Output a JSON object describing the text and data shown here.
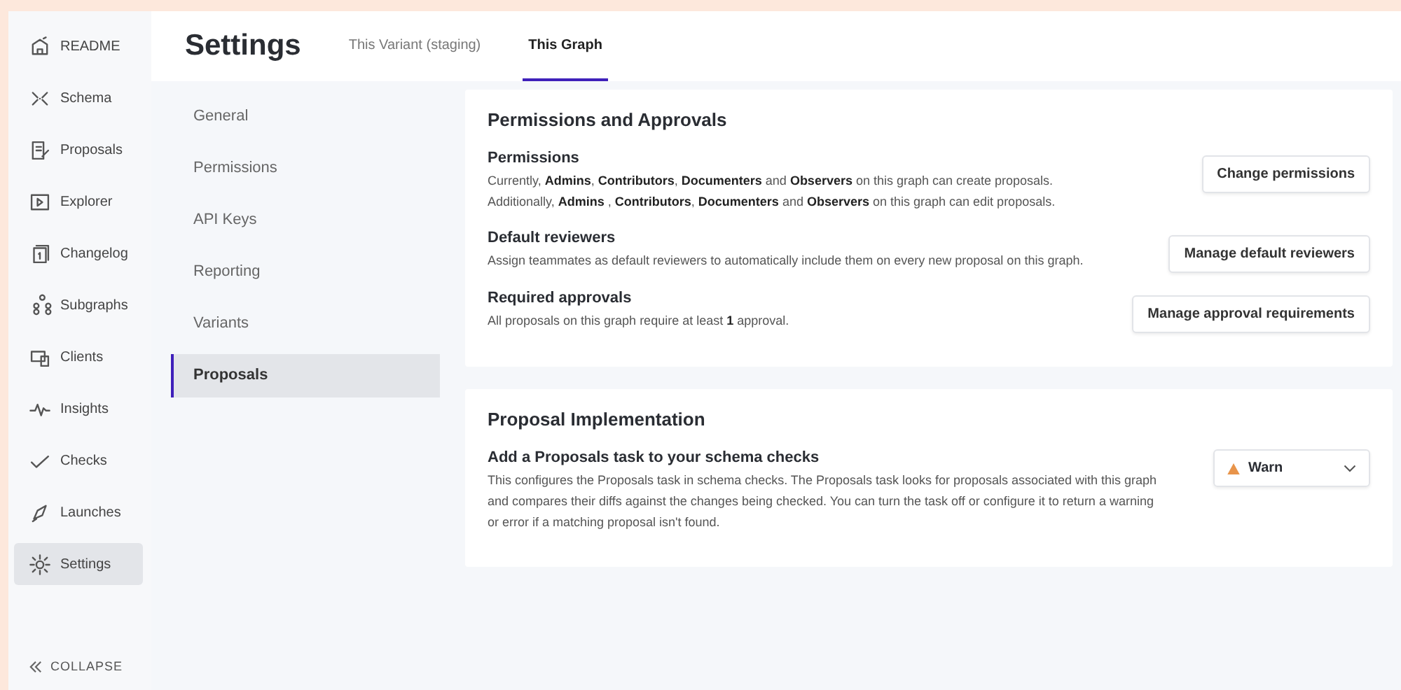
{
  "nav": {
    "items": [
      {
        "label": "README",
        "selected": false
      },
      {
        "label": "Schema",
        "selected": false
      },
      {
        "label": "Proposals",
        "selected": false
      },
      {
        "label": "Explorer",
        "selected": false
      },
      {
        "label": "Changelog",
        "selected": false
      },
      {
        "label": "Subgraphs",
        "selected": false
      },
      {
        "label": "Clients",
        "selected": false
      },
      {
        "label": "Insights",
        "selected": false
      },
      {
        "label": "Checks",
        "selected": false
      },
      {
        "label": "Launches",
        "selected": false
      },
      {
        "label": "Settings",
        "selected": true
      }
    ],
    "collapse": "COLLAPSE"
  },
  "header": {
    "title": "Settings",
    "tabs": [
      {
        "label": "This Variant (staging)",
        "selected": false
      },
      {
        "label": "This Graph",
        "selected": true
      }
    ]
  },
  "subnav": [
    {
      "label": "General",
      "selected": false
    },
    {
      "label": "Permissions",
      "selected": false
    },
    {
      "label": "API Keys",
      "selected": false
    },
    {
      "label": "Reporting",
      "selected": false
    },
    {
      "label": "Variants",
      "selected": false
    },
    {
      "label": "Proposals",
      "selected": true
    }
  ],
  "sections": [
    {
      "title": "Permissions and Approvals",
      "settings": [
        {
          "kind": "button",
          "title": "Permissions",
          "description": "Currently, **Admins**, **Contributors**, **Documenters** and **Observers** on this graph can create proposals.",
          "description_2": "Additionally, **Admins** , **Contributors**, **Documenters** and **Observers** on this graph can edit proposals.",
          "action": "Change permissions"
        },
        {
          "kind": "button",
          "title": "Default reviewers",
          "description": "Assign teammates as default reviewers to automatically include them on every new proposal on this graph.",
          "action": "Manage default reviewers"
        },
        {
          "kind": "button",
          "title": "Required approvals",
          "description": "All proposals on this graph require at least **1** approval.",
          "action": "Manage approval requirements"
        }
      ]
    },
    {
      "title": "Proposal Implementation",
      "settings": [
        {
          "kind": "select",
          "title": "Add a Proposals task to your schema checks",
          "description": "This configures the Proposals task in schema checks. The Proposals task looks for proposals associated with this graph and compares their diffs against the changes being checked. You can turn the task off or configure it to return a warning or error if a matching proposal isn't found.",
          "action": "Warn"
        }
      ]
    }
  ]
}
